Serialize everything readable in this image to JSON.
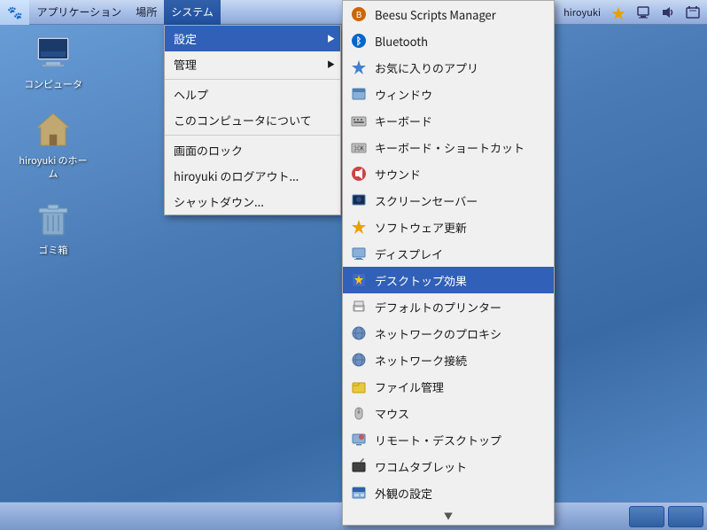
{
  "taskbar_top": {
    "items": [
      {
        "id": "apps",
        "label": "アプリケーション",
        "icon": "🐾"
      },
      {
        "id": "places",
        "label": "場所",
        "icon": ""
      },
      {
        "id": "system",
        "label": "システム",
        "active": true,
        "icon": ""
      }
    ],
    "right_items": [
      {
        "id": "firefox",
        "label": ""
      },
      {
        "id": "window1",
        "label": ""
      },
      {
        "id": "username",
        "label": "hiroyuki"
      },
      {
        "id": "star",
        "label": "★"
      },
      {
        "id": "monitor",
        "label": ""
      },
      {
        "id": "sound",
        "label": ""
      },
      {
        "id": "clock",
        "label": ""
      }
    ]
  },
  "system_menu": {
    "items": [
      {
        "id": "settings",
        "label": "設定",
        "has_submenu": true
      },
      {
        "id": "admin",
        "label": "管理",
        "has_submenu": true
      },
      {
        "id": "help",
        "label": "ヘルプ"
      },
      {
        "id": "about",
        "label": "このコンピュータについて"
      },
      {
        "id": "lock",
        "label": "画面のロック"
      },
      {
        "id": "logout",
        "label": "hiroyuki のログアウト..."
      },
      {
        "id": "shutdown",
        "label": "シャットダウン..."
      }
    ]
  },
  "settings_submenu": {
    "items": [
      {
        "id": "beesu",
        "label": "Beesu Scripts Manager",
        "icon": "🔧"
      },
      {
        "id": "bluetooth",
        "label": "Bluetooth",
        "icon": "🔵"
      },
      {
        "id": "fav-apps",
        "label": "お気に入りのアプリ",
        "icon": "💠"
      },
      {
        "id": "windows",
        "label": "ウィンドウ",
        "icon": "🖥"
      },
      {
        "id": "keyboard",
        "label": "キーボード",
        "icon": "⌨"
      },
      {
        "id": "keyboard-shortcut",
        "label": "キーボード・ショートカット",
        "icon": "⌨"
      },
      {
        "id": "sound",
        "label": "サウンド",
        "icon": "🎵"
      },
      {
        "id": "screensaver",
        "label": "スクリーンセーバー",
        "icon": "🖥"
      },
      {
        "id": "software-update",
        "label": "ソフトウェア更新",
        "icon": "⭐"
      },
      {
        "id": "display",
        "label": "ディスプレイ",
        "icon": "📺"
      },
      {
        "id": "desktop-effects",
        "label": "デスクトップ効果",
        "icon": "✨",
        "highlighted": true
      },
      {
        "id": "default-printer",
        "label": "デフォルトのプリンター",
        "icon": "🖨"
      },
      {
        "id": "network-proxy",
        "label": "ネットワークのプロキシ",
        "icon": "🌐"
      },
      {
        "id": "network-connect",
        "label": "ネットワーク接続",
        "icon": "🌐"
      },
      {
        "id": "file-mgmt",
        "label": "ファイル管理",
        "icon": "📁"
      },
      {
        "id": "mouse",
        "label": "マウス",
        "icon": "🖱"
      },
      {
        "id": "remote-desktop",
        "label": "リモート・デスクトップ",
        "icon": "🖥"
      },
      {
        "id": "wacom",
        "label": "ワコムタブレット",
        "icon": "✏"
      },
      {
        "id": "appearance",
        "label": "外観の設定",
        "icon": "🎨"
      }
    ]
  },
  "desktop_icons": [
    {
      "id": "computer",
      "label": "コンピュータ",
      "icon": "computer"
    },
    {
      "id": "home",
      "label": "hiroyuki のホーム",
      "icon": "home"
    },
    {
      "id": "trash",
      "label": "ゴミ箱",
      "icon": "trash"
    }
  ]
}
